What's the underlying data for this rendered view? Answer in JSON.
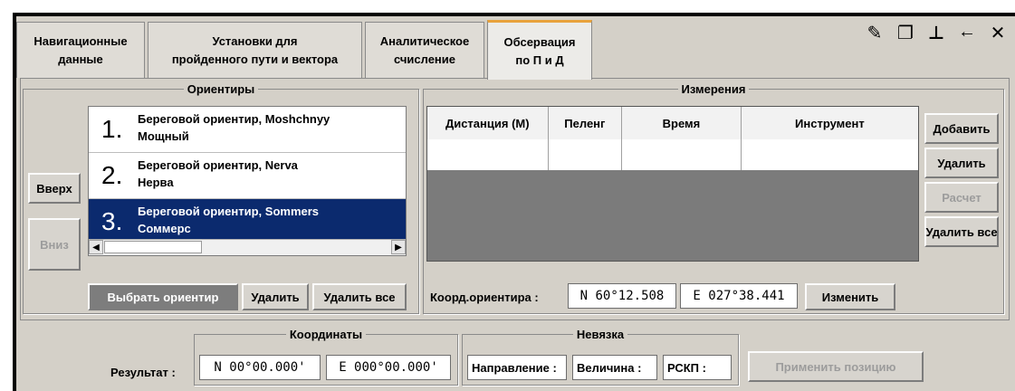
{
  "tabs": [
    {
      "label": "Навигационные\nданные",
      "active": false
    },
    {
      "label": "Установки для\nпройденного пути и вектора",
      "active": false
    },
    {
      "label": "Аналитическое\nсчисление",
      "active": false
    },
    {
      "label": "Обсервация\nпо П и Д",
      "active": true
    }
  ],
  "window_tools": {
    "pin_icon": "pin-icon",
    "restore_icon": "restore-icon",
    "dock_icon": "dock-icon",
    "back_icon": "back-arrow-icon",
    "close_icon": "close-icon",
    "glyphs": [
      "✎",
      "❐",
      "⊥",
      "←",
      "✕"
    ]
  },
  "landmarks": {
    "title": "Ориентиры",
    "up_label": "Вверх",
    "down_label": "Вниз",
    "items": [
      {
        "num": "1.",
        "line1": "Береговой ориентир, Moshchnyy",
        "line2": "Мощный",
        "selected": false
      },
      {
        "num": "2.",
        "line1": "Береговой ориентир, Nerva",
        "line2": "Нерва",
        "selected": false
      },
      {
        "num": "3.",
        "line1": "Береговой ориентир, Sommers",
        "line2": "Соммерс",
        "selected": true
      }
    ],
    "select_label": "Выбрать ориентир",
    "delete_label": "Удалить",
    "delete_all_label": "Удалить все"
  },
  "measurements": {
    "title": "Измерения",
    "columns": [
      "Дистанция (М)",
      "Пеленг",
      "Время",
      "Инструмент"
    ],
    "rows": [
      [
        "",
        "",
        "",
        ""
      ]
    ],
    "add_label": "Добавить",
    "delete_label": "Удалить",
    "calc_label": "Расчет",
    "delete_all_label": "Удалить все",
    "coord_label": "Коорд.ориентира :",
    "lat": "N 60°12.508",
    "lon": "E 027°38.441",
    "change_label": "Изменить"
  },
  "result": {
    "label": "Результат :",
    "coords_title": "Координаты",
    "lat": "N 00°00.000'",
    "lon": "E 000°00.000'",
    "error_title": "Невязка",
    "direction_label": "Направление :",
    "magnitude_label": "Величина :",
    "rskp_label": "РСКП :",
    "apply_label": "Применить позицию"
  },
  "colors": {
    "selection": "#0b2a6e",
    "active_tab_accent": "#e8a23c",
    "panel": "#d4d0c8",
    "table_empty": "#7b7b7b"
  }
}
